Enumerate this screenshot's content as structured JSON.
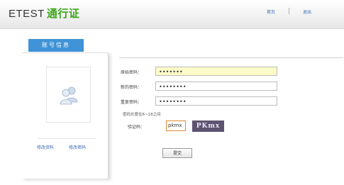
{
  "header": {
    "brand_en": "ETEST",
    "brand_cn": "通行证",
    "links": [
      "首页",
      "退出"
    ]
  },
  "tab": {
    "label": "账号信息"
  },
  "sidebar": {
    "avatar_icon": "users-icon",
    "links": [
      "修改资料",
      "修改密码"
    ]
  },
  "form": {
    "old_password_label": "原始密码：",
    "old_password_value": "•••••••",
    "new_password_label": "新的密码：",
    "new_password_value": "••••••••",
    "repeat_password_label": "重复密码：",
    "repeat_password_value": "••••••••",
    "hint": "密码长度在6~18之间",
    "captcha_label": "验证码：",
    "captcha_value": "pkmx",
    "captcha_image_text": "PKmx",
    "submit_label": "提交"
  },
  "colors": {
    "accent_blue": "#3f93d6",
    "brand_green": "#3aa517",
    "highlight_yellow": "#fbfbc8"
  }
}
